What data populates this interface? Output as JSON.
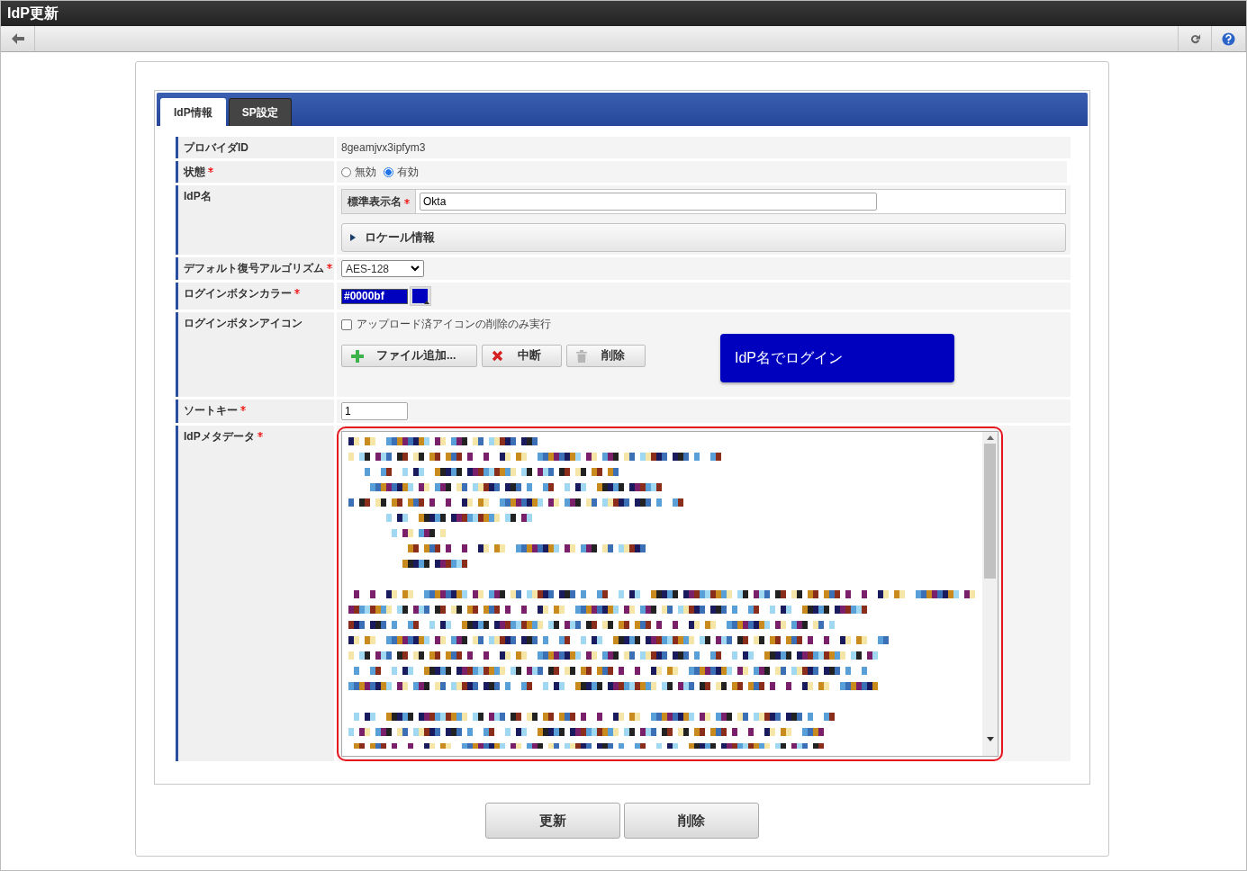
{
  "window": {
    "title": "IdP更新"
  },
  "tabs": [
    {
      "label": "IdP情報",
      "selected": true
    },
    {
      "label": "SP設定",
      "selected": false
    }
  ],
  "fields": [
    {
      "kind": "text",
      "label": "プロバイダID",
      "required": false,
      "value": "8geamjvx3ipfym3"
    },
    {
      "kind": "radio",
      "label": "状態",
      "required": true,
      "options": [
        {
          "label": "無効",
          "selected": false
        },
        {
          "label": "有効",
          "selected": true
        }
      ]
    },
    {
      "kind": "idp_name",
      "label": "IdP名",
      "required": false,
      "sub_label": "標準表示名",
      "sub_required": true,
      "value": "Okta",
      "locale_section": {
        "label": "ロケール情報",
        "expanded": false
      }
    },
    {
      "kind": "select",
      "label": "デフォルト復号アルゴリズム",
      "required": true,
      "value": "AES-128"
    },
    {
      "kind": "color",
      "label": "ログインボタンカラー",
      "required": true,
      "value": "#0000bf"
    },
    {
      "kind": "icon",
      "label": "ログインボタンアイコン",
      "required": false,
      "checkbox": {
        "label": "アップロード済アイコンの削除のみ実行",
        "checked": false
      },
      "buttons": [
        {
          "kind": "add",
          "label": "ファイル追加..."
        },
        {
          "kind": "cancel",
          "label": "中断"
        },
        {
          "kind": "delete",
          "label": "削除"
        }
      ],
      "preview": {
        "label": "IdP名でログイン"
      }
    },
    {
      "kind": "input",
      "label": "ソートキー",
      "required": true,
      "value": "1"
    },
    {
      "kind": "metadata",
      "label": "IdPメタデータ",
      "required": true,
      "highlighted": true
    }
  ],
  "actions": [
    {
      "label": "更新"
    },
    {
      "label": "削除"
    }
  ]
}
